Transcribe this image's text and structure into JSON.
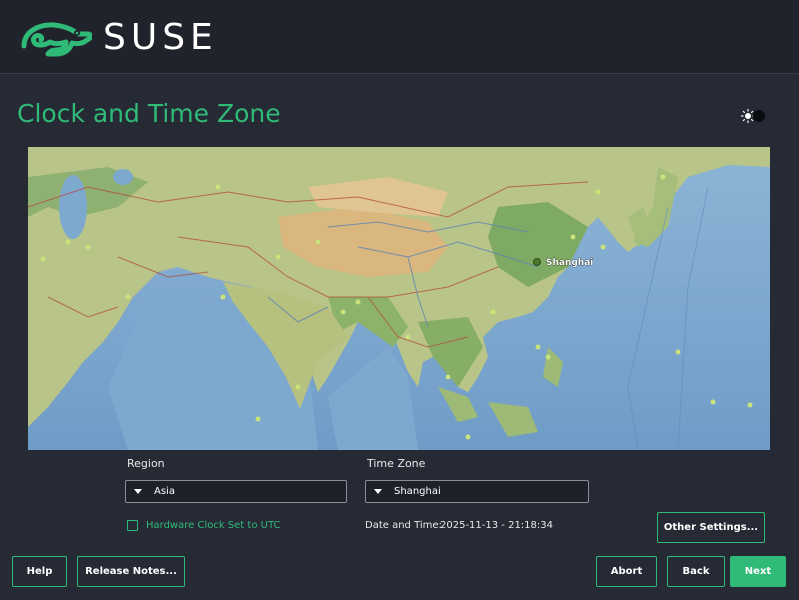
{
  "header": {
    "brand": "SUSE"
  },
  "page": {
    "title": "Clock and Time Zone"
  },
  "map": {
    "selected_city_label": "Shanghai"
  },
  "region": {
    "label": "Region",
    "value": "Asia"
  },
  "timezone": {
    "label": "Time Zone",
    "value": "Shanghai"
  },
  "hwclock": {
    "label": "Hardware Clock Set to UTC",
    "checked": false
  },
  "datetime": {
    "label": "Date and Time:",
    "value": "2025-11-13 - 21:18:34"
  },
  "buttons": {
    "other_settings": "Other Settings...",
    "help": "Help",
    "release_notes": "Release Notes...",
    "abort": "Abort",
    "back": "Back",
    "next": "Next"
  },
  "colors": {
    "accent": "#30ba78",
    "background": "#262a35",
    "header": "#20232c"
  }
}
